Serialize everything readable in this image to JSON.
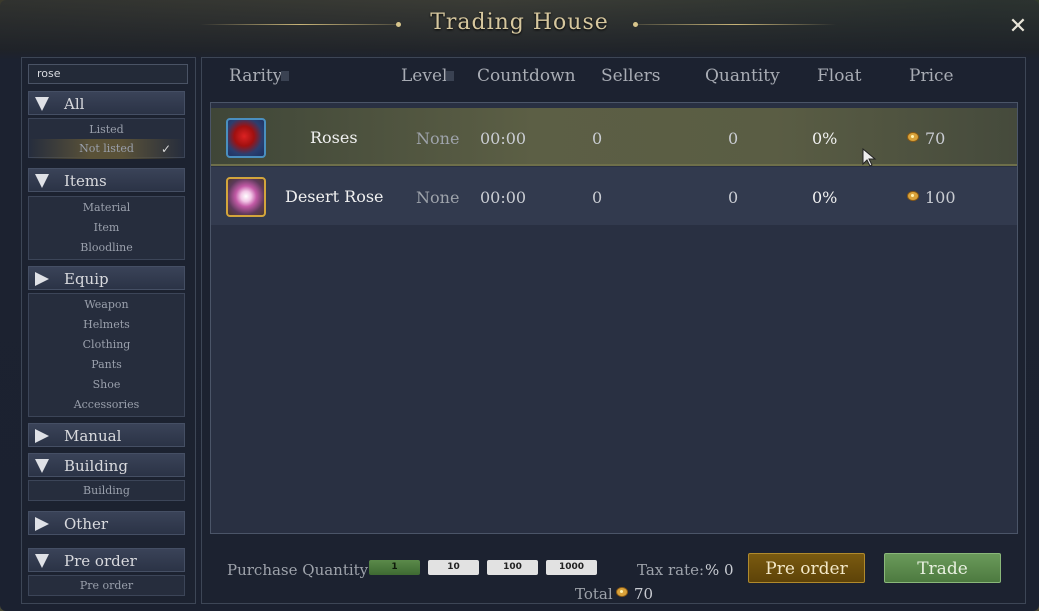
{
  "window": {
    "title": "Trading House"
  },
  "search": {
    "value": "rose"
  },
  "sidebar": {
    "all": {
      "label": "All",
      "items": [
        {
          "label": "Listed"
        },
        {
          "label": "Not listed"
        }
      ]
    },
    "items": {
      "label": "Items",
      "items": [
        {
          "label": "Material"
        },
        {
          "label": "Item"
        },
        {
          "label": "Bloodline"
        }
      ]
    },
    "equip": {
      "label": "Equip",
      "items": [
        {
          "label": "Weapon"
        },
        {
          "label": "Helmets"
        },
        {
          "label": "Clothing"
        },
        {
          "label": "Pants"
        },
        {
          "label": "Shoe"
        },
        {
          "label": "Accessories"
        }
      ]
    },
    "manual": {
      "label": "Manual"
    },
    "building": {
      "label": "Building",
      "items": [
        {
          "label": "Building"
        }
      ]
    },
    "other": {
      "label": "Other"
    },
    "preorder": {
      "label": "Pre order",
      "items": [
        {
          "label": "Pre order"
        }
      ]
    }
  },
  "table": {
    "headers": {
      "rarity": "Rarity",
      "level": "Level",
      "countdown": "Countdown",
      "sellers": "Sellers",
      "quantity": "Quantity",
      "float": "Float",
      "price": "Price"
    },
    "rows": [
      {
        "name": "Roses",
        "level": "None",
        "countdown": "00:00",
        "sellers": "0",
        "quantity": "0",
        "float": "0%",
        "price": "70",
        "icon": "red-rose-icon"
      },
      {
        "name": "Desert Rose",
        "level": "None",
        "countdown": "00:00",
        "sellers": "0",
        "quantity": "0",
        "float": "0%",
        "price": "100",
        "icon": "pink-flower-icon"
      }
    ]
  },
  "footer": {
    "purchase_quantity_label": "Purchase Quantity",
    "quantities": [
      "1",
      "10",
      "100",
      "1000"
    ],
    "selected_quantity": "1",
    "tax_label": "Tax rate:",
    "tax_value": "% 0",
    "total_label": "Total",
    "total_value": "70",
    "preorder_button": "Pre order",
    "trade_button": "Trade"
  },
  "colors": {
    "accent_gold": "#d9a23a",
    "trade_green": "#5b8a4a",
    "preorder_brown": "#6e4f0c"
  }
}
